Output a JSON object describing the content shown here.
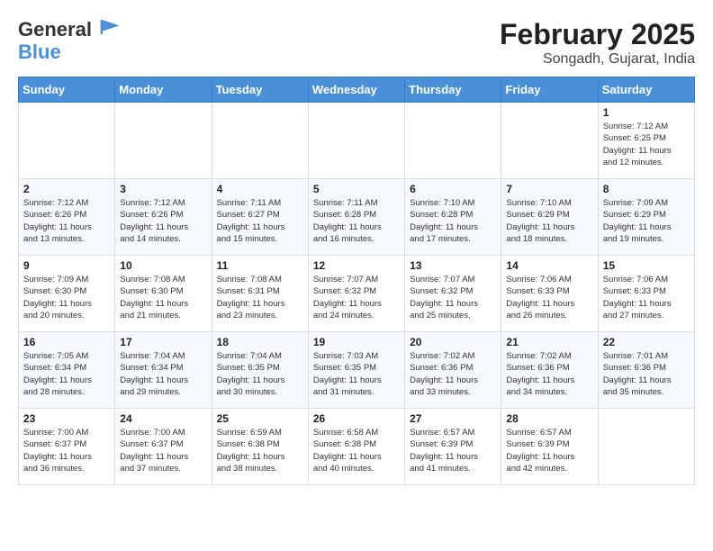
{
  "header": {
    "logo_line1": "General",
    "logo_line2": "Blue",
    "title": "February 2025",
    "subtitle": "Songadh, Gujarat, India"
  },
  "days_of_week": [
    "Sunday",
    "Monday",
    "Tuesday",
    "Wednesday",
    "Thursday",
    "Friday",
    "Saturday"
  ],
  "weeks": [
    [
      {
        "day": "",
        "info": ""
      },
      {
        "day": "",
        "info": ""
      },
      {
        "day": "",
        "info": ""
      },
      {
        "day": "",
        "info": ""
      },
      {
        "day": "",
        "info": ""
      },
      {
        "day": "",
        "info": ""
      },
      {
        "day": "1",
        "info": "Sunrise: 7:12 AM\nSunset: 6:25 PM\nDaylight: 11 hours\nand 12 minutes."
      }
    ],
    [
      {
        "day": "2",
        "info": "Sunrise: 7:12 AM\nSunset: 6:26 PM\nDaylight: 11 hours\nand 13 minutes."
      },
      {
        "day": "3",
        "info": "Sunrise: 7:12 AM\nSunset: 6:26 PM\nDaylight: 11 hours\nand 14 minutes."
      },
      {
        "day": "4",
        "info": "Sunrise: 7:11 AM\nSunset: 6:27 PM\nDaylight: 11 hours\nand 15 minutes."
      },
      {
        "day": "5",
        "info": "Sunrise: 7:11 AM\nSunset: 6:28 PM\nDaylight: 11 hours\nand 16 minutes."
      },
      {
        "day": "6",
        "info": "Sunrise: 7:10 AM\nSunset: 6:28 PM\nDaylight: 11 hours\nand 17 minutes."
      },
      {
        "day": "7",
        "info": "Sunrise: 7:10 AM\nSunset: 6:29 PM\nDaylight: 11 hours\nand 18 minutes."
      },
      {
        "day": "8",
        "info": "Sunrise: 7:09 AM\nSunset: 6:29 PM\nDaylight: 11 hours\nand 19 minutes."
      }
    ],
    [
      {
        "day": "9",
        "info": "Sunrise: 7:09 AM\nSunset: 6:30 PM\nDaylight: 11 hours\nand 20 minutes."
      },
      {
        "day": "10",
        "info": "Sunrise: 7:08 AM\nSunset: 6:30 PM\nDaylight: 11 hours\nand 21 minutes."
      },
      {
        "day": "11",
        "info": "Sunrise: 7:08 AM\nSunset: 6:31 PM\nDaylight: 11 hours\nand 23 minutes."
      },
      {
        "day": "12",
        "info": "Sunrise: 7:07 AM\nSunset: 6:32 PM\nDaylight: 11 hours\nand 24 minutes."
      },
      {
        "day": "13",
        "info": "Sunrise: 7:07 AM\nSunset: 6:32 PM\nDaylight: 11 hours\nand 25 minutes."
      },
      {
        "day": "14",
        "info": "Sunrise: 7:06 AM\nSunset: 6:33 PM\nDaylight: 11 hours\nand 26 minutes."
      },
      {
        "day": "15",
        "info": "Sunrise: 7:06 AM\nSunset: 6:33 PM\nDaylight: 11 hours\nand 27 minutes."
      }
    ],
    [
      {
        "day": "16",
        "info": "Sunrise: 7:05 AM\nSunset: 6:34 PM\nDaylight: 11 hours\nand 28 minutes."
      },
      {
        "day": "17",
        "info": "Sunrise: 7:04 AM\nSunset: 6:34 PM\nDaylight: 11 hours\nand 29 minutes."
      },
      {
        "day": "18",
        "info": "Sunrise: 7:04 AM\nSunset: 6:35 PM\nDaylight: 11 hours\nand 30 minutes."
      },
      {
        "day": "19",
        "info": "Sunrise: 7:03 AM\nSunset: 6:35 PM\nDaylight: 11 hours\nand 31 minutes."
      },
      {
        "day": "20",
        "info": "Sunrise: 7:02 AM\nSunset: 6:36 PM\nDaylight: 11 hours\nand 33 minutes."
      },
      {
        "day": "21",
        "info": "Sunrise: 7:02 AM\nSunset: 6:36 PM\nDaylight: 11 hours\nand 34 minutes."
      },
      {
        "day": "22",
        "info": "Sunrise: 7:01 AM\nSunset: 6:36 PM\nDaylight: 11 hours\nand 35 minutes."
      }
    ],
    [
      {
        "day": "23",
        "info": "Sunrise: 7:00 AM\nSunset: 6:37 PM\nDaylight: 11 hours\nand 36 minutes."
      },
      {
        "day": "24",
        "info": "Sunrise: 7:00 AM\nSunset: 6:37 PM\nDaylight: 11 hours\nand 37 minutes."
      },
      {
        "day": "25",
        "info": "Sunrise: 6:59 AM\nSunset: 6:38 PM\nDaylight: 11 hours\nand 38 minutes."
      },
      {
        "day": "26",
        "info": "Sunrise: 6:58 AM\nSunset: 6:38 PM\nDaylight: 11 hours\nand 40 minutes."
      },
      {
        "day": "27",
        "info": "Sunrise: 6:57 AM\nSunset: 6:39 PM\nDaylight: 11 hours\nand 41 minutes."
      },
      {
        "day": "28",
        "info": "Sunrise: 6:57 AM\nSunset: 6:39 PM\nDaylight: 11 hours\nand 42 minutes."
      },
      {
        "day": "",
        "info": ""
      }
    ]
  ]
}
